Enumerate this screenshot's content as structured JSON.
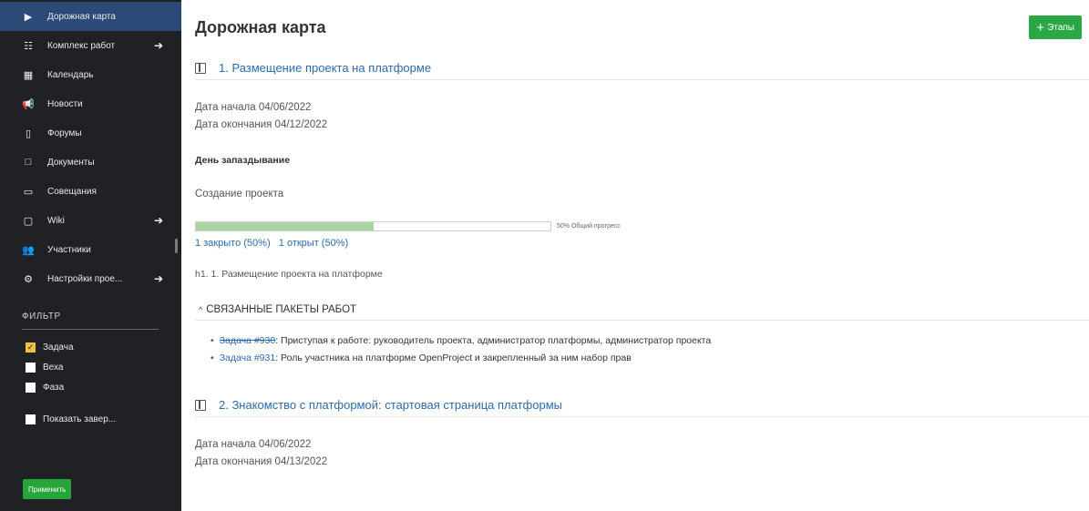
{
  "sidebar": {
    "items": [
      {
        "label": "Дорожная карта",
        "icon": "roadmap-icon",
        "glyph": "▶",
        "active": true,
        "arrow": false
      },
      {
        "label": "Комплекс работ",
        "icon": "work-packages-icon",
        "glyph": "☷",
        "active": false,
        "arrow": true
      },
      {
        "label": "Календарь",
        "icon": "calendar-icon",
        "glyph": "▦",
        "active": false,
        "arrow": false
      },
      {
        "label": "Новости",
        "icon": "megaphone-icon",
        "glyph": "📢",
        "active": false,
        "arrow": false
      },
      {
        "label": "Форумы",
        "icon": "forum-icon",
        "glyph": "▯",
        "active": false,
        "arrow": false
      },
      {
        "label": "Документы",
        "icon": "documents-icon",
        "glyph": "□",
        "active": false,
        "arrow": false
      },
      {
        "label": "Совещания",
        "icon": "meetings-icon",
        "glyph": "▭",
        "active": false,
        "arrow": false
      },
      {
        "label": "Wiki",
        "icon": "wiki-book-icon",
        "glyph": "▢",
        "active": false,
        "arrow": true
      },
      {
        "label": "Участники",
        "icon": "members-icon",
        "glyph": "👥",
        "active": false,
        "arrow": false
      },
      {
        "label": "Настройки прое...",
        "icon": "settings-gear-icon",
        "glyph": "⚙",
        "active": false,
        "arrow": true
      }
    ],
    "arrow_glyph": "➔",
    "filter_title": "ФИЛЬТР",
    "filters": [
      {
        "label": "Задача",
        "checked": true
      },
      {
        "label": "Веха",
        "checked": false
      },
      {
        "label": "Фаза",
        "checked": false
      }
    ],
    "show_completed_label": "Показать завер...",
    "apply_label": "Применить"
  },
  "main": {
    "title": "Дорожная карта",
    "stages_button": {
      "plus": "+",
      "label": "Этапы"
    },
    "version1": {
      "title": "1. Размещение проекта на платформе",
      "start_date": "Дата начала 04/06/2022",
      "end_date": "Дата окончания 04/12/2022",
      "delay_label": "День запаздывание",
      "description": "Создание проекта",
      "progress_percent": 50,
      "progress_label": "50% Общий прогресс",
      "closed_link": "1 закрыто (50%)",
      "open_link": "1 открыт (50%)",
      "wiki_text": "h1. 1. Размещение проекта на платформе",
      "related_title": "СВЯЗАННЫЕ ПАКЕТЫ РАБОТ",
      "related_caret": "^",
      "related": [
        {
          "link": "Задача #930",
          "text": ": Приступая к работе: руководитель проекта, администратор платформы, администратор проекта",
          "strike": true
        },
        {
          "link": "Задача #931",
          "text": ": Роль участника на платформе OpenProject и закрепленный за ним набор прав",
          "strike": false
        }
      ]
    },
    "version2": {
      "title": "2. Знакомство с платформой: стартовая страница платформы",
      "start_date": "Дата начала 04/06/2022",
      "end_date": "Дата окончания 04/13/2022"
    }
  },
  "colors": {
    "sidebar_bg": "#1f2124",
    "active_bg": "#2c4a77",
    "link": "#2d6aa7",
    "green_button": "#2aa846",
    "progress_fill": "#a8d5a1"
  }
}
